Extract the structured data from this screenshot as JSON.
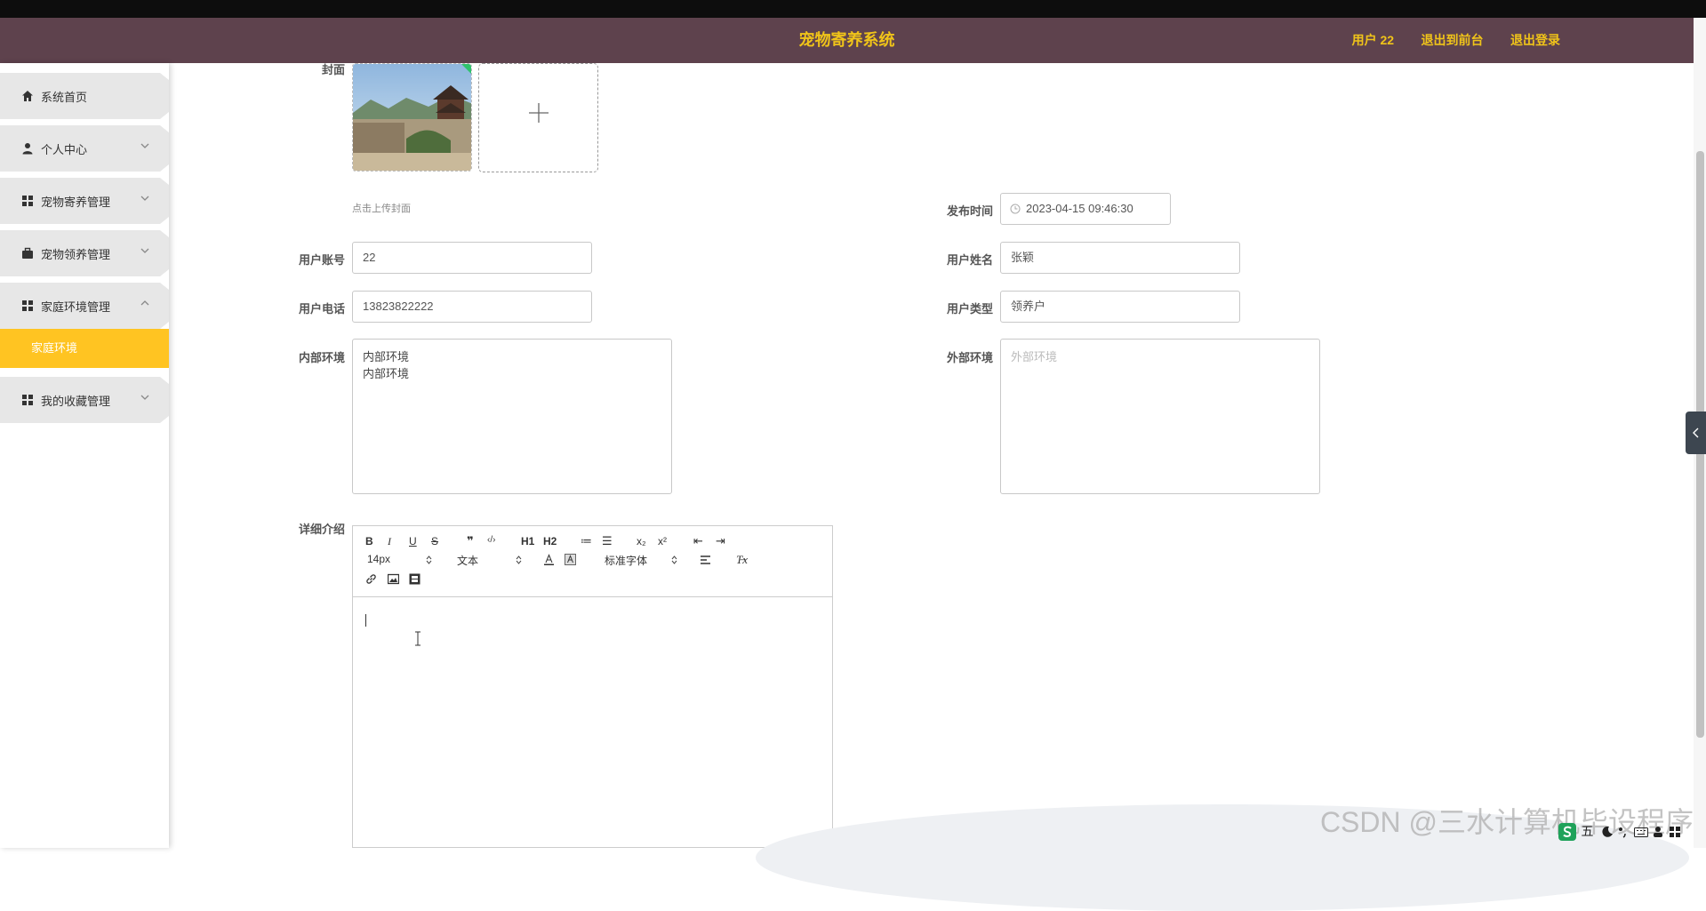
{
  "header": {
    "title": "宠物寄养系统",
    "nav": [
      "用户 22",
      "退出到前台",
      "退出登录"
    ]
  },
  "sidebar": {
    "items": [
      {
        "label": "系统首页",
        "icon": "home-icon"
      },
      {
        "label": "个人中心",
        "icon": "user-icon"
      },
      {
        "label": "宠物寄养管理",
        "icon": "grid-icon"
      },
      {
        "label": "宠物领养管理",
        "icon": "briefcase-icon"
      },
      {
        "label": "家庭环境管理",
        "icon": "grid-icon"
      },
      {
        "label": "我的收藏管理",
        "icon": "grid-icon"
      }
    ],
    "active_sub": "家庭环境"
  },
  "form": {
    "cover_label": "封面",
    "cover_hint": "点击上传封面",
    "publish_time_label": "发布时间",
    "publish_time_value": "2023-04-15 09:46:30",
    "account_label": "用户账号",
    "account_value": "22",
    "name_label": "用户姓名",
    "name_value": "张颖",
    "phone_label": "用户电话",
    "phone_value": "13823822222",
    "type_label": "用户类型",
    "type_value": "领养户",
    "inner_label": "内部环境",
    "inner_value": "内部环境\n内部环境",
    "outer_label": "外部环境",
    "outer_placeholder": "外部环境",
    "detail_label": "详细介绍"
  },
  "editor": {
    "buttons": [
      "B",
      "I",
      "U",
      "S",
      "❞",
      "‹/›",
      "H1",
      "H2",
      "≔",
      "☰",
      "x₂",
      "x²",
      "⇤",
      "⇥"
    ],
    "size": "14px",
    "header": "文本",
    "font": "标准字体",
    "clean": "T̶x"
  },
  "watermark": "CSDN @三水计算机毕设程序",
  "taskbar": {
    "ime": "五"
  },
  "colors": {
    "header_bg": "#5e424d",
    "accent": "#f0c419",
    "active_menu": "#ffc422"
  }
}
